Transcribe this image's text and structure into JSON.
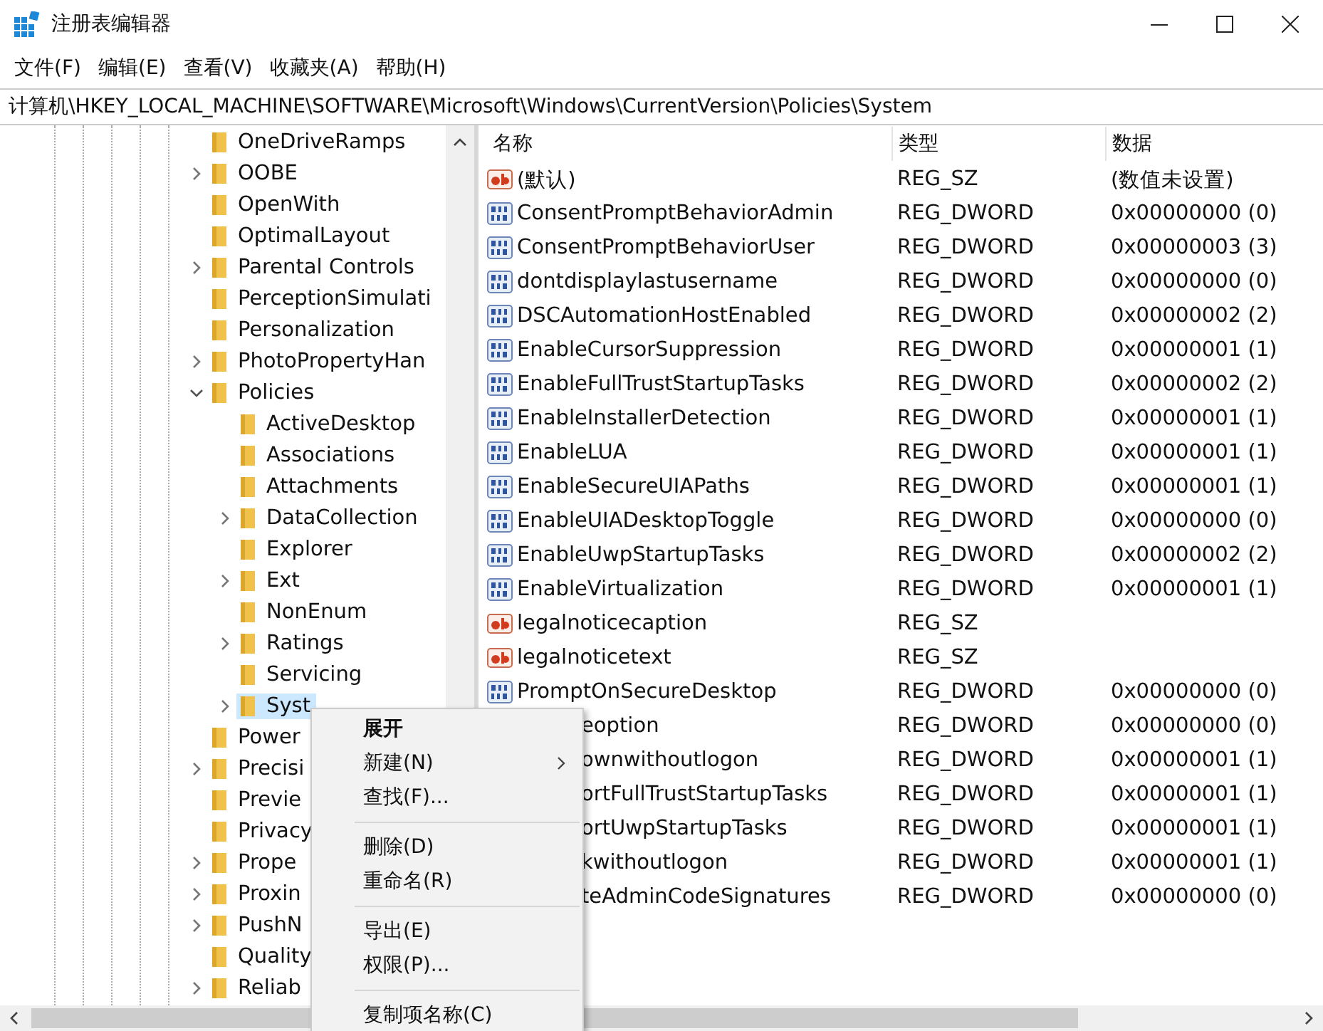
{
  "window": {
    "title": "注册表编辑器"
  },
  "menu_bar": [
    "文件(F)",
    "编辑(E)",
    "查看(V)",
    "收藏夹(A)",
    "帮助(H)"
  ],
  "address": "计算机\\HKEY_LOCAL_MACHINE\\SOFTWARE\\Microsoft\\Windows\\CurrentVersion\\Policies\\System",
  "tree": [
    {
      "label": "OneDriveRamps",
      "expandable": false,
      "selected": false
    },
    {
      "label": "OOBE",
      "expandable": true,
      "expanded": false,
      "selected": false
    },
    {
      "label": "OpenWith",
      "expandable": false,
      "selected": false
    },
    {
      "label": "OptimalLayout",
      "expandable": false,
      "selected": false
    },
    {
      "label": "Parental Controls",
      "expandable": true,
      "expanded": false,
      "selected": false
    },
    {
      "label": "PerceptionSimulati",
      "expandable": false,
      "selected": false
    },
    {
      "label": "Personalization",
      "expandable": false,
      "selected": false
    },
    {
      "label": "PhotoPropertyHan",
      "expandable": true,
      "expanded": false,
      "selected": false
    },
    {
      "label": "Policies",
      "expandable": true,
      "expanded": true,
      "selected": false,
      "children": [
        {
          "label": "ActiveDesktop",
          "expandable": false,
          "selected": false
        },
        {
          "label": "Associations",
          "expandable": false,
          "selected": false
        },
        {
          "label": "Attachments",
          "expandable": false,
          "selected": false
        },
        {
          "label": "DataCollection",
          "expandable": true,
          "expanded": false,
          "selected": false
        },
        {
          "label": "Explorer",
          "expandable": false,
          "selected": false
        },
        {
          "label": "Ext",
          "expandable": true,
          "expanded": false,
          "selected": false
        },
        {
          "label": "NonEnum",
          "expandable": false,
          "selected": false
        },
        {
          "label": "Ratings",
          "expandable": true,
          "expanded": false,
          "selected": false
        },
        {
          "label": "Servicing",
          "expandable": false,
          "selected": false
        },
        {
          "label": "Syst",
          "expandable": true,
          "expanded": false,
          "selected": true
        }
      ]
    },
    {
      "label": "Power",
      "expandable": false,
      "selected": false
    },
    {
      "label": "Precisi",
      "expandable": true,
      "expanded": false,
      "selected": false
    },
    {
      "label": "Previe",
      "expandable": false,
      "selected": false
    },
    {
      "label": "Privacy",
      "expandable": false,
      "selected": false
    },
    {
      "label": "Prope",
      "expandable": true,
      "expanded": false,
      "selected": false
    },
    {
      "label": "Proxin",
      "expandable": true,
      "expanded": false,
      "selected": false
    },
    {
      "label": "PushN",
      "expandable": true,
      "expanded": false,
      "selected": false
    },
    {
      "label": "Quality",
      "expandable": false,
      "selected": false
    },
    {
      "label": "Reliab",
      "expandable": true,
      "expanded": false,
      "selected": false
    }
  ],
  "table": {
    "columns": [
      "名称",
      "类型",
      "数据"
    ],
    "rows": [
      {
        "name": "(默认)",
        "kind": "string",
        "type": "REG_SZ",
        "data": "(数值未设置)"
      },
      {
        "name": "ConsentPromptBehaviorAdmin",
        "kind": "dword",
        "type": "REG_DWORD",
        "data": "0x00000000 (0)"
      },
      {
        "name": "ConsentPromptBehaviorUser",
        "kind": "dword",
        "type": "REG_DWORD",
        "data": "0x00000003 (3)"
      },
      {
        "name": "dontdisplaylastusername",
        "kind": "dword",
        "type": "REG_DWORD",
        "data": "0x00000000 (0)"
      },
      {
        "name": "DSCAutomationHostEnabled",
        "kind": "dword",
        "type": "REG_DWORD",
        "data": "0x00000002 (2)"
      },
      {
        "name": "EnableCursorSuppression",
        "kind": "dword",
        "type": "REG_DWORD",
        "data": "0x00000001 (1)"
      },
      {
        "name": "EnableFullTrustStartupTasks",
        "kind": "dword",
        "type": "REG_DWORD",
        "data": "0x00000002 (2)"
      },
      {
        "name": "EnableInstallerDetection",
        "kind": "dword",
        "type": "REG_DWORD",
        "data": "0x00000001 (1)"
      },
      {
        "name": "EnableLUA",
        "kind": "dword",
        "type": "REG_DWORD",
        "data": "0x00000001 (1)"
      },
      {
        "name": "EnableSecureUIAPaths",
        "kind": "dword",
        "type": "REG_DWORD",
        "data": "0x00000001 (1)"
      },
      {
        "name": "EnableUIADesktopToggle",
        "kind": "dword",
        "type": "REG_DWORD",
        "data": "0x00000000 (0)"
      },
      {
        "name": "EnableUwpStartupTasks",
        "kind": "dword",
        "type": "REG_DWORD",
        "data": "0x00000002 (2)"
      },
      {
        "name": "EnableVirtualization",
        "kind": "dword",
        "type": "REG_DWORD",
        "data": "0x00000001 (1)"
      },
      {
        "name": "legalnoticecaption",
        "kind": "string",
        "type": "REG_SZ"
      },
      {
        "name": "legalnoticetext",
        "kind": "string",
        "type": "REG_SZ"
      },
      {
        "name": "PromptOnSecureDesktop",
        "kind": "dword",
        "type": "REG_DWORD",
        "data": "0x00000000 (0)"
      },
      {
        "name": "eoption",
        "type": "REG_DWORD",
        "data": "0x00000000 (0)"
      },
      {
        "name": "ownwithoutlogon",
        "type": "REG_DWORD",
        "data": "0x00000001 (1)"
      },
      {
        "name": "ortFullTrustStartupTasks",
        "type": "REG_DWORD",
        "data": "0x00000001 (1)"
      },
      {
        "name": "ortUwpStartupTasks",
        "type": "REG_DWORD",
        "data": "0x00000001 (1)"
      },
      {
        "name": "kwithoutlogon",
        "type": "REG_DWORD",
        "data": "0x00000001 (1)"
      },
      {
        "name": "teAdminCodeSignatures",
        "type": "REG_DWORD",
        "data": "0x00000000 (0)"
      }
    ]
  },
  "context_menu": [
    {
      "kind": "item",
      "label": "展开",
      "default": true,
      "submenu": false
    },
    {
      "kind": "item",
      "label": "新建(N)",
      "default": false,
      "submenu": true
    },
    {
      "kind": "item",
      "label": "查找(F)...",
      "default": false,
      "submenu": false
    },
    {
      "kind": "separator"
    },
    {
      "kind": "item",
      "label": "删除(D)",
      "default": false,
      "submenu": false
    },
    {
      "kind": "item",
      "label": "重命名(R)",
      "default": false,
      "submenu": false
    },
    {
      "kind": "separator"
    },
    {
      "kind": "item",
      "label": "导出(E)",
      "default": false,
      "submenu": false
    },
    {
      "kind": "item",
      "label": "权限(P)...",
      "default": false,
      "submenu": false
    },
    {
      "kind": "separator"
    },
    {
      "kind": "item",
      "label": "复制项名称(C)",
      "default": false,
      "submenu": false
    }
  ]
}
